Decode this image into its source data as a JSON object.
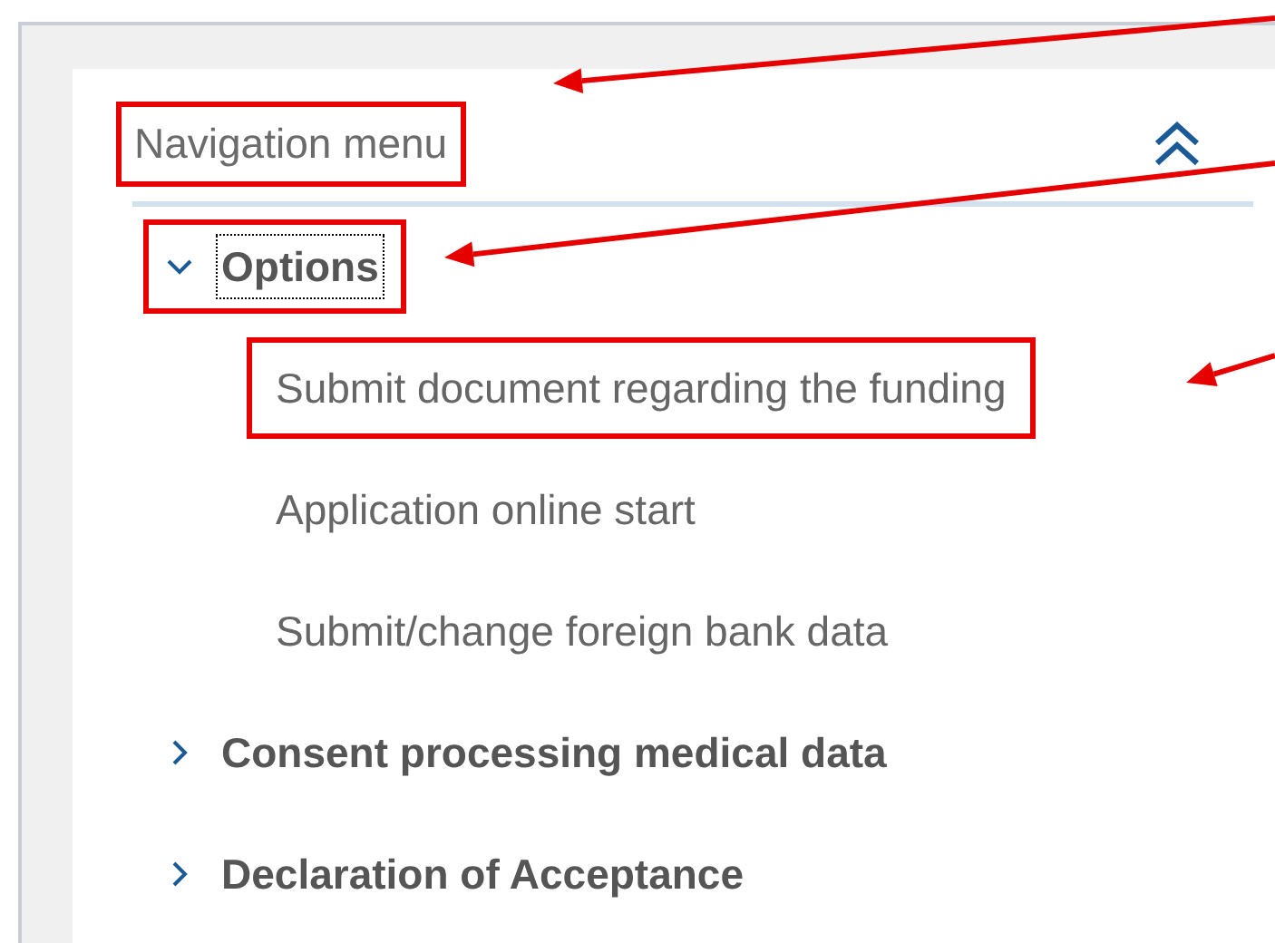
{
  "navigation": {
    "title": "Navigation menu",
    "annotated": true,
    "expanded": true,
    "groups": [
      {
        "label": "Options",
        "expanded": true,
        "focused": true,
        "annotated": true,
        "children": [
          {
            "label": "Submit document regarding the funding",
            "annotated": true
          },
          {
            "label": "Application online start",
            "annotated": false
          },
          {
            "label": "Submit/change foreign bank data",
            "annotated": false
          }
        ]
      },
      {
        "label": "Consent processing medical data",
        "expanded": false,
        "focused": false,
        "annotated": false
      },
      {
        "label": "Declaration of Acceptance",
        "expanded": false,
        "focused": false,
        "annotated": false
      }
    ]
  }
}
